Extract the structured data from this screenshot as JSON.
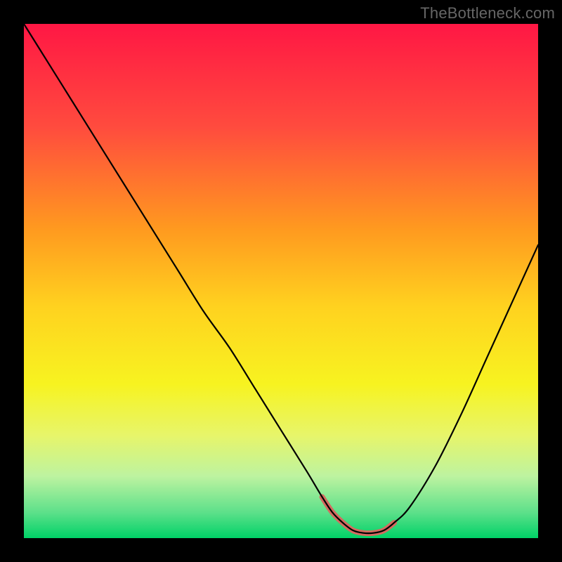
{
  "watermark": "TheBottleneck.com",
  "chart_data": {
    "type": "line",
    "title": "",
    "xlabel": "",
    "ylabel": "",
    "xlim": [
      0,
      100
    ],
    "ylim": [
      0,
      100
    ],
    "x": [
      0,
      5,
      10,
      15,
      20,
      25,
      30,
      35,
      40,
      45,
      50,
      55,
      58,
      60,
      62,
      64,
      66,
      68,
      70,
      72,
      75,
      80,
      85,
      90,
      95,
      100
    ],
    "values": [
      100,
      92,
      84,
      76,
      68,
      60,
      52,
      44,
      37,
      29,
      21,
      13,
      8,
      5,
      3,
      1.5,
      1,
      1,
      1.5,
      3,
      6,
      14,
      24,
      35,
      46,
      57
    ],
    "highlight": {
      "x_start": 58,
      "x_end": 72,
      "color": "#d46a5f",
      "stroke_width": 8
    },
    "background_gradient": {
      "stops": [
        {
          "offset": 0,
          "color": "#ff1744"
        },
        {
          "offset": 20,
          "color": "#ff4b3e"
        },
        {
          "offset": 40,
          "color": "#ff9a1f"
        },
        {
          "offset": 55,
          "color": "#ffd21f"
        },
        {
          "offset": 70,
          "color": "#f7f320"
        },
        {
          "offset": 80,
          "color": "#e7f56a"
        },
        {
          "offset": 88,
          "color": "#bdf3a0"
        },
        {
          "offset": 95,
          "color": "#5de08a"
        },
        {
          "offset": 100,
          "color": "#00d267"
        }
      ]
    },
    "curve_color": "#000000",
    "curve_width": 2.2
  }
}
